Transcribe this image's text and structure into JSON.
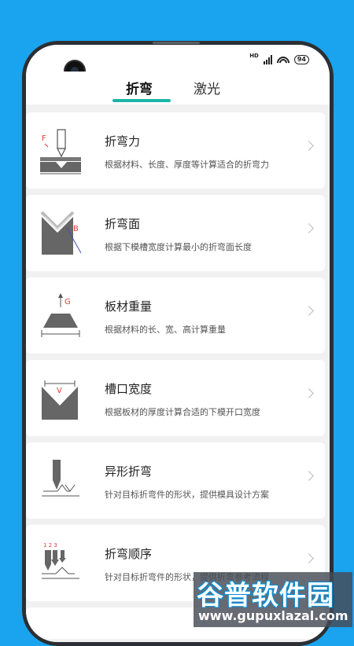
{
  "status": {
    "hd": "HD",
    "battery": "94"
  },
  "tabs": [
    {
      "label": "折弯",
      "active": true
    },
    {
      "label": "激光",
      "active": false
    }
  ],
  "accent_color": "#1bb5a6",
  "items": [
    {
      "title": "折弯力",
      "desc": "根据材料、长度、厚度等计算适合的折弯力",
      "icon": "bending-force-icon",
      "icon_letter": "F"
    },
    {
      "title": "折弯面",
      "desc": "根据下模槽宽度计算最小的折弯面长度",
      "icon": "bending-face-icon",
      "icon_letter": "B"
    },
    {
      "title": "板材重量",
      "desc": "根据材料的长、宽、高计算重量",
      "icon": "sheet-weight-icon",
      "icon_letter": "G"
    },
    {
      "title": "槽口宽度",
      "desc": "根据板材的厚度计算合适的下模开口宽度",
      "icon": "notch-width-icon",
      "icon_letter": "V"
    },
    {
      "title": "异形折弯",
      "desc": "针对目标折弯件的形状，提供模具设计方案",
      "icon": "special-bending-icon"
    },
    {
      "title": "折弯顺序",
      "desc": "针对目标折弯件的形状，提供折弯参考流程",
      "icon": "bending-order-icon",
      "icon_letter": "1 2 3"
    }
  ],
  "watermark": {
    "title": "谷普软件园",
    "url": "www.gupuxlazal.com"
  }
}
